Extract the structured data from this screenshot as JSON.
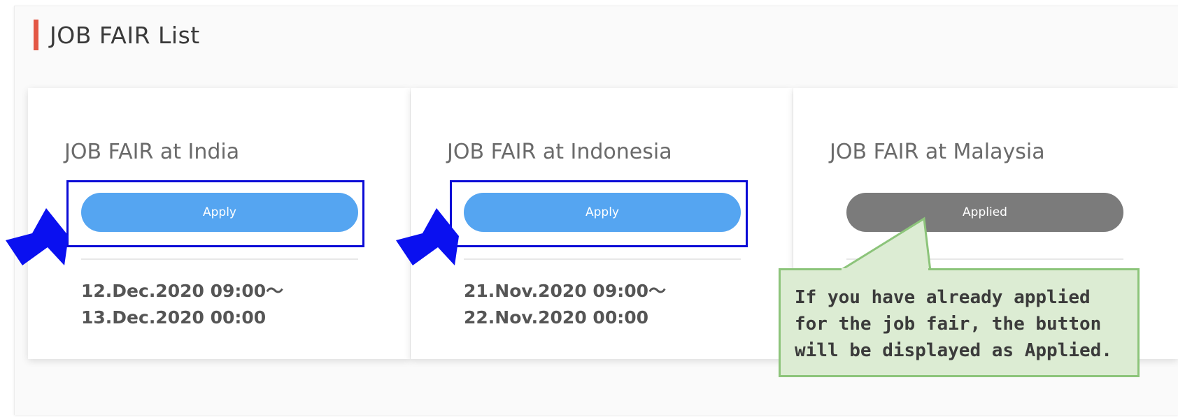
{
  "page": {
    "title": "JOB FAIR List"
  },
  "cards": [
    {
      "title": "JOB FAIR at India",
      "button_label": "Apply",
      "button_state": "apply",
      "date_start": "12.Dec.2020 09:00〜",
      "date_end": "13.Dec.2020 00:00"
    },
    {
      "title": "JOB FAIR at Indonesia",
      "button_label": "Apply",
      "button_state": "apply",
      "date_start": "21.Nov.2020 09:00〜",
      "date_end": "22.Nov.2020 00:00"
    },
    {
      "title": "JOB FAIR at Malaysia",
      "button_label": "Applied",
      "button_state": "applied",
      "date_start": "",
      "date_end": ""
    }
  ],
  "annotation": {
    "line1": "If you have already applied",
    "line2": "for the job fair, the button",
    "line3": "will be displayed as Applied."
  },
  "colors": {
    "accent_bar": "#e35745",
    "apply_button": "#55a5f1",
    "applied_button": "#7b7b7b",
    "highlight_border": "#0b0bd6",
    "pointer_arrow": "#0a10f0",
    "callout_fill": "#dcecd3",
    "callout_border": "#8cc47a"
  },
  "icons": {
    "pointer": "arrow-right-icon"
  }
}
